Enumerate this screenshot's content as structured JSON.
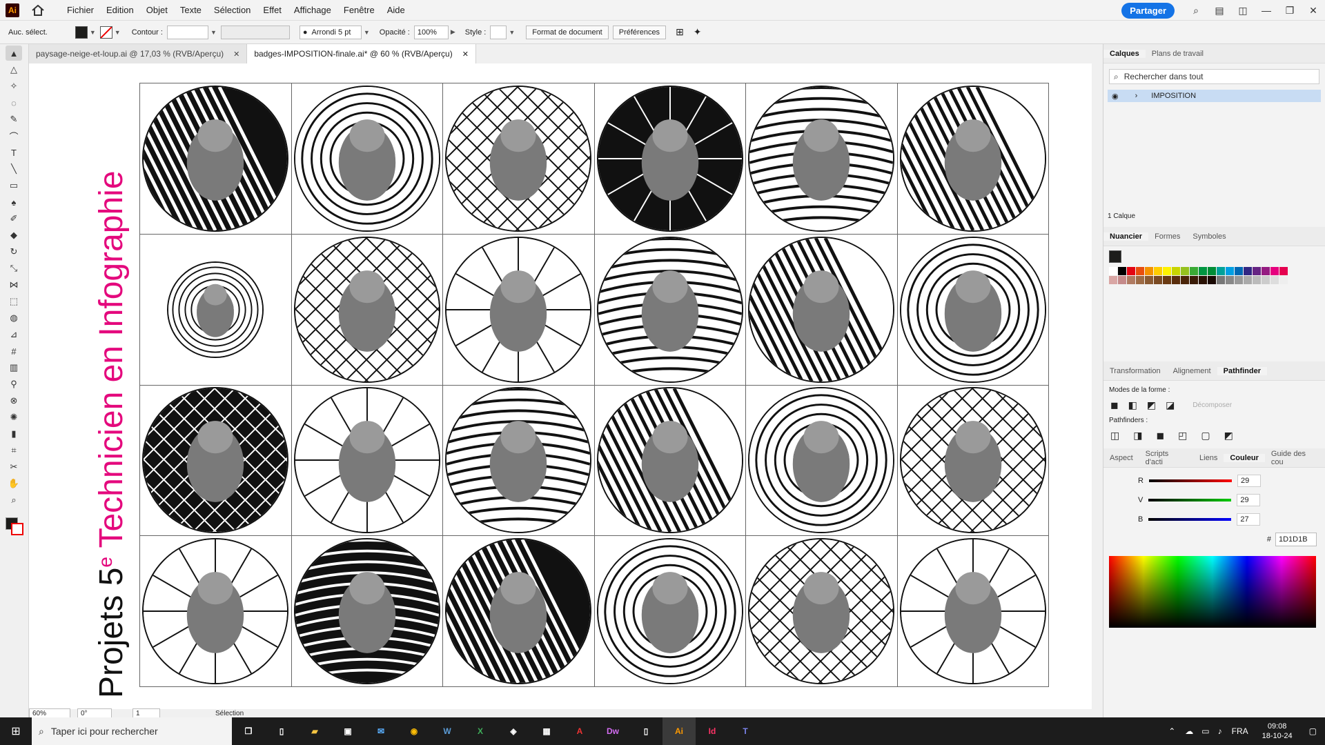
{
  "app": {
    "logo": "Ai",
    "menus": [
      "Fichier",
      "Edition",
      "Objet",
      "Texte",
      "Sélection",
      "Effet",
      "Affichage",
      "Fenêtre",
      "Aide"
    ],
    "share_label": "Partager"
  },
  "control": {
    "selection": "Auc. sélect.",
    "contour_label": "Contour :",
    "brush": "Arrondi 5 pt",
    "opacity_label": "Opacité :",
    "opacity": "100%",
    "style_label": "Style :",
    "doc_button": "Format de document",
    "prefs_button": "Préférences"
  },
  "tabs": [
    {
      "label": "paysage-neige-et-loup.ai @ 17,03 % (RVB/Aperçu)"
    },
    {
      "label": "badges-IMPOSITION-finale.ai* @ 60 % (RVB/Aperçu)"
    }
  ],
  "artboard": {
    "title_prefix": "Projets 5",
    "title_sup": "e",
    "title_main": " Technicien en Infographie",
    "accent": "#e4097d"
  },
  "status": {
    "zoom": "60%",
    "rotation": "0°",
    "page": "1",
    "tool": "Sélection"
  },
  "layers_panel": {
    "tabs": [
      "Calques",
      "Plans de travail"
    ],
    "search_placeholder": "Rechercher dans tout",
    "layer_name": "IMPOSITION",
    "count": "1 Calque"
  },
  "swatch_panel": {
    "tabs": [
      "Nuancier",
      "Formes",
      "Symboles"
    ]
  },
  "pathfinder_panel": {
    "tabs": [
      "Transformation",
      "Alignement",
      "Pathfinder"
    ],
    "modes_label": "Modes de la forme :",
    "expand": "Décomposer",
    "pathfinders_label": "Pathfinders :"
  },
  "color_panel": {
    "tabs": [
      "Aspect",
      "Scripts d'acti",
      "Liens",
      "Couleur",
      "Guide des cou"
    ],
    "r": "29",
    "v": "29",
    "b": "27",
    "hex": "1D1D1B",
    "r_label": "R",
    "v_label": "V",
    "b_label": "B"
  },
  "taskbar": {
    "search": "Taper ici pour rechercher",
    "lang": "FRA",
    "time": "09:08",
    "date": "18-10-24"
  }
}
